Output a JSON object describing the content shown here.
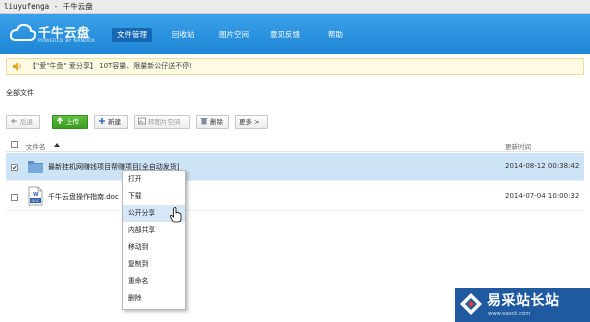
{
  "window": {
    "title": "liuyufenga - 千牛云盘"
  },
  "logo": {
    "name": "千牛云盘",
    "sub": "POWERED BY NANDOX"
  },
  "nav": [
    "文件管理",
    "回收站",
    "图片空间",
    "意见反馈",
    "帮助"
  ],
  "notice": "【\"爱\"牛盘\" 爱分享】 10T容量、限量新公仔送不停!",
  "breadcrumb": "全部文件",
  "toolbar": {
    "back": "后退",
    "upload": "上传",
    "new": "新建",
    "to_image_space": "转图片空间",
    "delete": "删除",
    "more": "更多 >"
  },
  "columns": {
    "name": "文件名",
    "time": "更新时间"
  },
  "files": [
    {
      "name": "最新挂机网赚钱项目帮赚项目[全自动发货]",
      "time": "2014-08-12 00:38:42"
    },
    {
      "name": "千牛云盘操作指南.doc",
      "time": "2014-07-04 10:00:32"
    }
  ],
  "context_menu": [
    "打开",
    "下载",
    "公开分享",
    "内部共享",
    "移动到",
    "复制到",
    "重命名",
    "删除"
  ],
  "watermark": {
    "text": "易采站长站",
    "url": "www.easck.com"
  },
  "colors": {
    "header": "#1f86d6",
    "upload": "#3d9a25",
    "selected_row": "#cde3f6",
    "watermark": "#1f5aa0"
  }
}
